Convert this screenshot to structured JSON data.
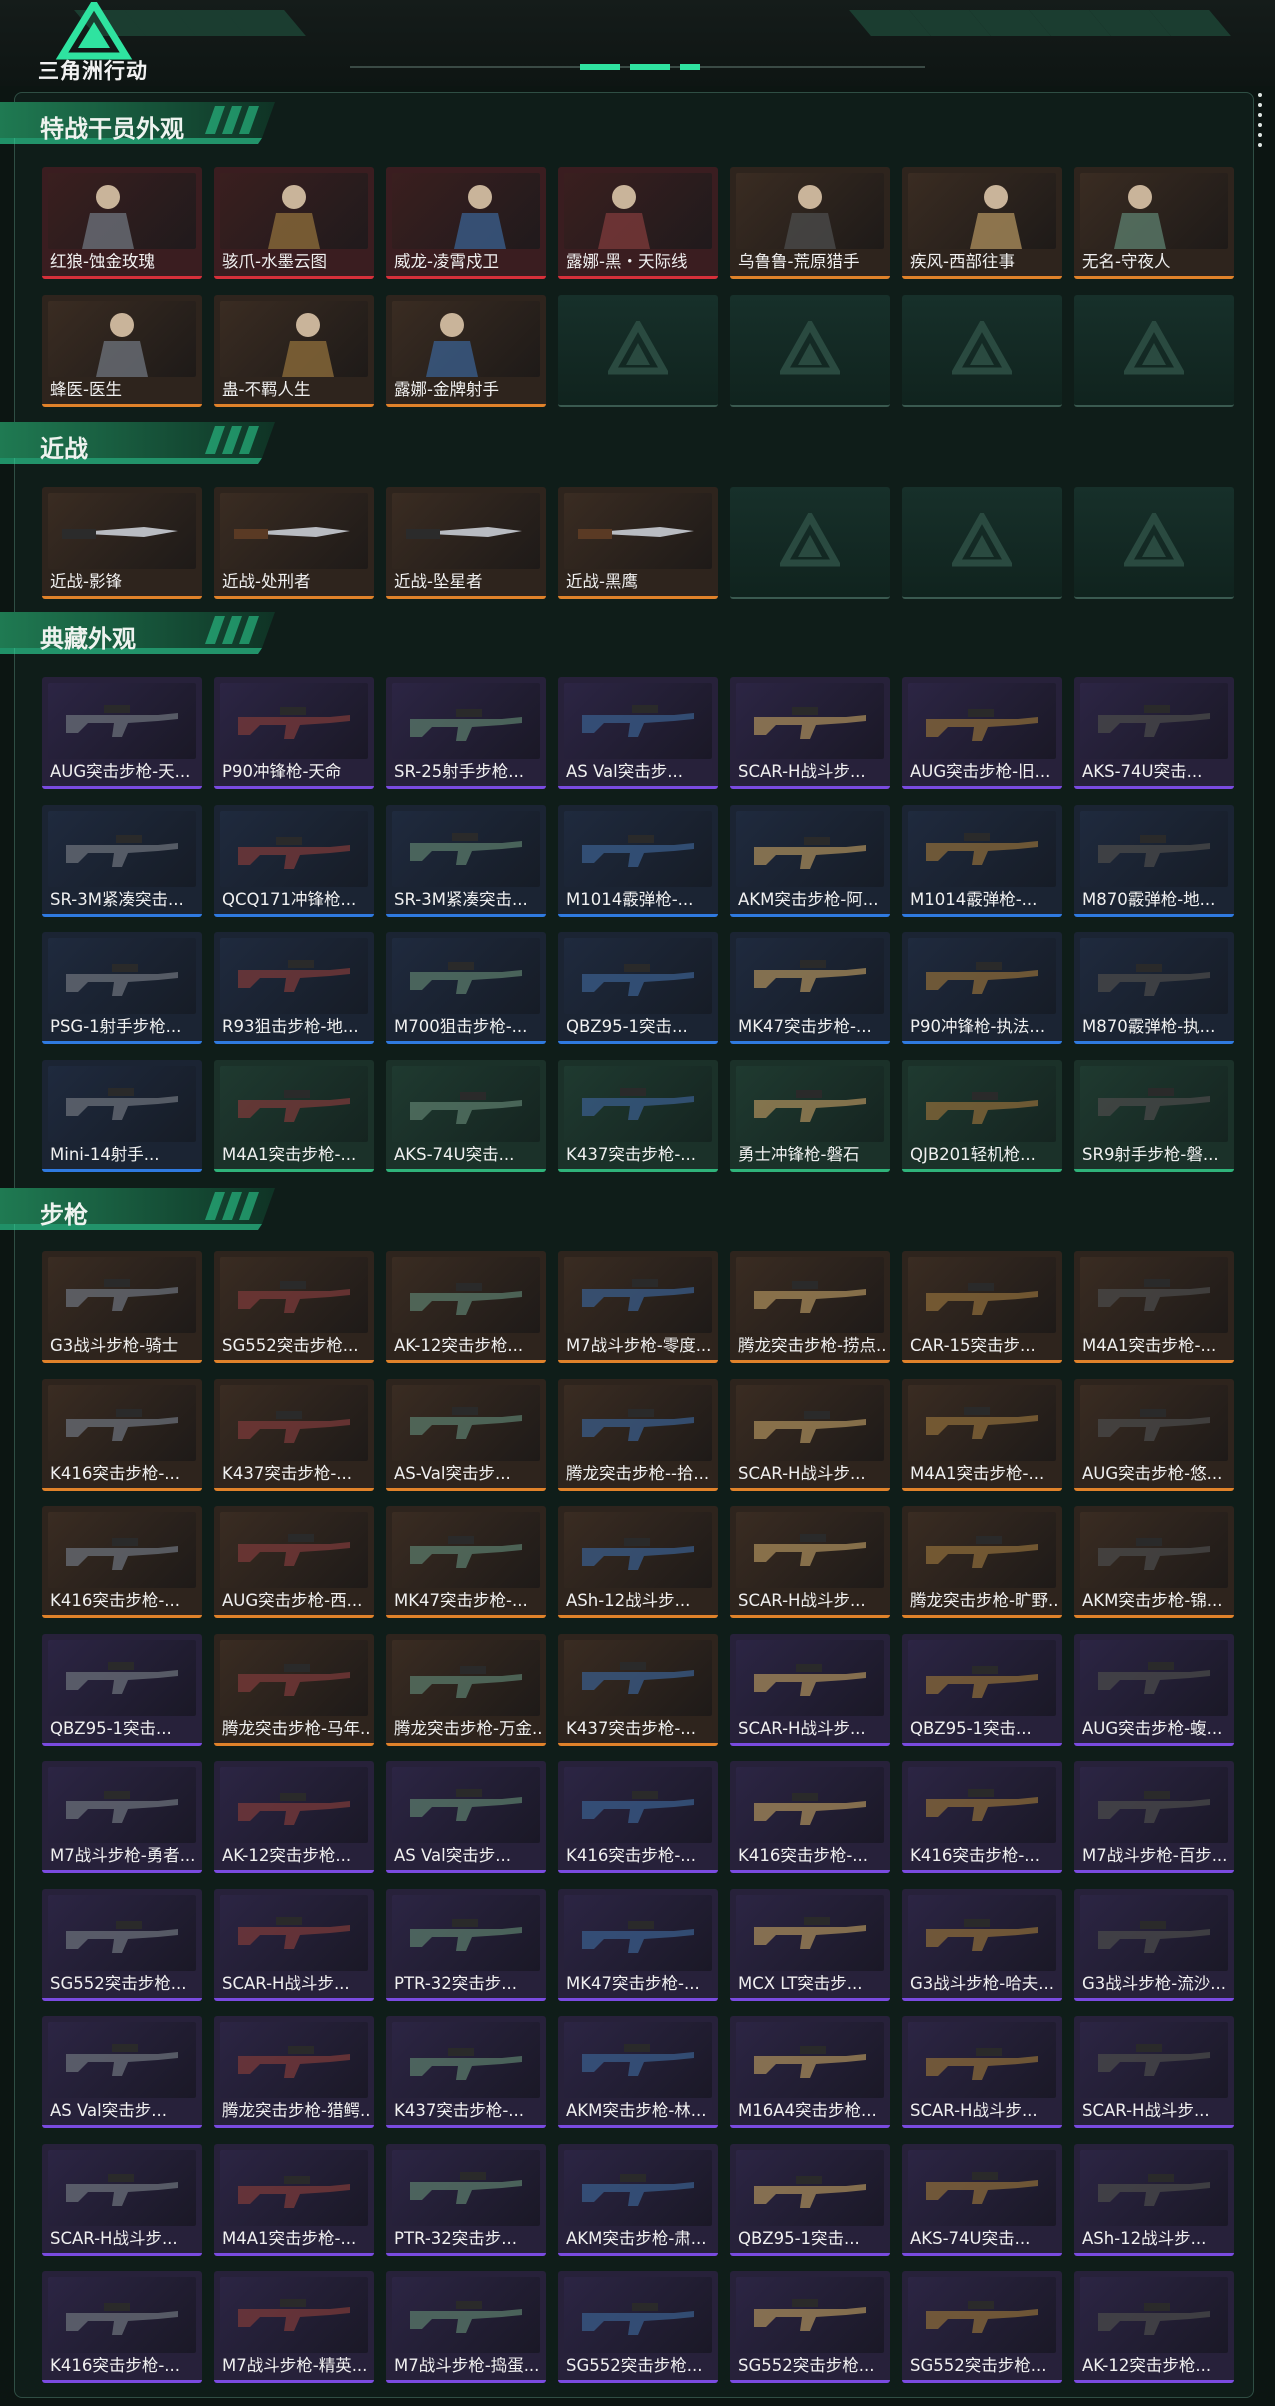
{
  "app": {
    "title": "三角洲行动"
  },
  "sections": [
    {
      "title": "特战干员外观",
      "rows": 2,
      "items": [
        {
          "label": "红狼-蚀金玫瑰",
          "rarity": "red"
        },
        {
          "label": "骇爪-水墨云图",
          "rarity": "red"
        },
        {
          "label": "威龙-凌霄戍卫",
          "rarity": "red"
        },
        {
          "label": "露娜-黑・天际线",
          "rarity": "red"
        },
        {
          "label": "乌鲁鲁-荒原猎手",
          "rarity": "orange"
        },
        {
          "label": "疾风-西部往事",
          "rarity": "orange"
        },
        {
          "label": "无名-守夜人",
          "rarity": "orange"
        },
        {
          "label": "蜂医-医生",
          "rarity": "orange"
        },
        {
          "label": "蛊-不羁人生",
          "rarity": "orange"
        },
        {
          "label": "露娜-金牌射手",
          "rarity": "orange"
        }
      ]
    },
    {
      "title": "近战",
      "rows": 1,
      "items": [
        {
          "label": "近战-影锋",
          "rarity": "orange"
        },
        {
          "label": "近战-处刑者",
          "rarity": "orange"
        },
        {
          "label": "近战-坠星者",
          "rarity": "orange"
        },
        {
          "label": "近战-黑鹰",
          "rarity": "orange"
        }
      ]
    },
    {
      "title": "典藏外观",
      "rows": 4,
      "items": [
        {
          "label": "AUG突击步枪-天...",
          "rarity": "purple"
        },
        {
          "label": "P90冲锋枪-天命",
          "rarity": "purple"
        },
        {
          "label": "SR-25射手步枪...",
          "rarity": "purple"
        },
        {
          "label": "AS Val突击步...",
          "rarity": "purple"
        },
        {
          "label": "SCAR-H战斗步...",
          "rarity": "purple"
        },
        {
          "label": "AUG突击步枪-旧...",
          "rarity": "purple"
        },
        {
          "label": "AKS-74U突击...",
          "rarity": "purple"
        },
        {
          "label": "SR-3M紧凑突击...",
          "rarity": "blue"
        },
        {
          "label": "QCQ171冲锋枪...",
          "rarity": "blue"
        },
        {
          "label": "SR-3M紧凑突击...",
          "rarity": "blue"
        },
        {
          "label": "M1014霰弹枪-...",
          "rarity": "blue"
        },
        {
          "label": "AKM突击步枪-阿...",
          "rarity": "blue"
        },
        {
          "label": "M1014霰弹枪-...",
          "rarity": "blue"
        },
        {
          "label": "M870霰弹枪-地...",
          "rarity": "blue"
        },
        {
          "label": "PSG-1射手步枪...",
          "rarity": "blue"
        },
        {
          "label": "R93狙击步枪-地...",
          "rarity": "blue"
        },
        {
          "label": "M700狙击步枪-...",
          "rarity": "blue"
        },
        {
          "label": "QBZ95-1突击...",
          "rarity": "blue"
        },
        {
          "label": "MK47突击步枪-...",
          "rarity": "blue"
        },
        {
          "label": "P90冲锋枪-执法...",
          "rarity": "blue"
        },
        {
          "label": "M870霰弹枪-执...",
          "rarity": "blue"
        },
        {
          "label": "Mini-14射手...",
          "rarity": "blue"
        },
        {
          "label": "M4A1突击步枪-...",
          "rarity": "green"
        },
        {
          "label": "AKS-74U突击...",
          "rarity": "green"
        },
        {
          "label": "K437突击步枪-...",
          "rarity": "green"
        },
        {
          "label": "勇士冲锋枪-磐石",
          "rarity": "green"
        },
        {
          "label": "QJB201轻机枪...",
          "rarity": "green"
        },
        {
          "label": "SR9射手步枪-磐...",
          "rarity": "green"
        }
      ]
    },
    {
      "title": "步枪",
      "rows": 9,
      "items": [
        {
          "label": "G3战斗步枪-骑士",
          "rarity": "orange"
        },
        {
          "label": "SG552突击步枪...",
          "rarity": "orange"
        },
        {
          "label": "AK-12突击步枪...",
          "rarity": "orange"
        },
        {
          "label": "M7战斗步枪-零度...",
          "rarity": "orange"
        },
        {
          "label": "腾龙突击步枪-捞点...",
          "rarity": "orange"
        },
        {
          "label": "CAR-15突击步...",
          "rarity": "orange"
        },
        {
          "label": "M4A1突击步枪-...",
          "rarity": "orange"
        },
        {
          "label": "K416突击步枪-...",
          "rarity": "orange"
        },
        {
          "label": "K437突击步枪-...",
          "rarity": "orange"
        },
        {
          "label": "AS-Val突击步...",
          "rarity": "orange"
        },
        {
          "label": "腾龙突击步枪--拾...",
          "rarity": "orange"
        },
        {
          "label": "SCAR-H战斗步...",
          "rarity": "orange"
        },
        {
          "label": "M4A1突击步枪-...",
          "rarity": "orange"
        },
        {
          "label": "AUG突击步枪-悠...",
          "rarity": "orange"
        },
        {
          "label": "K416突击步枪-...",
          "rarity": "orange"
        },
        {
          "label": "AUG突击步枪-西...",
          "rarity": "orange"
        },
        {
          "label": "MK47突击步枪-...",
          "rarity": "orange"
        },
        {
          "label": "ASh-12战斗步...",
          "rarity": "orange"
        },
        {
          "label": "SCAR-H战斗步...",
          "rarity": "orange"
        },
        {
          "label": "腾龙突击步枪-旷野...",
          "rarity": "orange"
        },
        {
          "label": "AKM突击步枪-锦...",
          "rarity": "orange"
        },
        {
          "label": "QBZ95-1突击...",
          "rarity": "purple"
        },
        {
          "label": "腾龙突击步枪-马年...",
          "rarity": "orange"
        },
        {
          "label": "腾龙突击步枪-万金...",
          "rarity": "orange"
        },
        {
          "label": "K437突击步枪-...",
          "rarity": "orange"
        },
        {
          "label": "SCAR-H战斗步...",
          "rarity": "purple"
        },
        {
          "label": "QBZ95-1突击...",
          "rarity": "purple"
        },
        {
          "label": "AUG突击步枪-蝮...",
          "rarity": "purple"
        },
        {
          "label": "M7战斗步枪-勇者...",
          "rarity": "purple"
        },
        {
          "label": "AK-12突击步枪...",
          "rarity": "purple"
        },
        {
          "label": "AS Val突击步...",
          "rarity": "purple"
        },
        {
          "label": "K416突击步枪-...",
          "rarity": "purple"
        },
        {
          "label": "K416突击步枪-...",
          "rarity": "purple"
        },
        {
          "label": "K416突击步枪-...",
          "rarity": "purple"
        },
        {
          "label": "M7战斗步枪-百步...",
          "rarity": "purple"
        },
        {
          "label": "SG552突击步枪...",
          "rarity": "purple"
        },
        {
          "label": "SCAR-H战斗步...",
          "rarity": "purple"
        },
        {
          "label": "PTR-32突击步...",
          "rarity": "purple"
        },
        {
          "label": "MK47突击步枪-...",
          "rarity": "purple"
        },
        {
          "label": "MCX LT突击步...",
          "rarity": "purple"
        },
        {
          "label": "G3战斗步枪-哈夫...",
          "rarity": "purple"
        },
        {
          "label": "G3战斗步枪-流沙...",
          "rarity": "purple"
        },
        {
          "label": "AS Val突击步...",
          "rarity": "purple"
        },
        {
          "label": "腾龙突击步枪-猎鳄...",
          "rarity": "purple"
        },
        {
          "label": "K437突击步枪-...",
          "rarity": "purple"
        },
        {
          "label": "AKM突击步枪-林...",
          "rarity": "purple"
        },
        {
          "label": "M16A4突击步枪...",
          "rarity": "purple"
        },
        {
          "label": "SCAR-H战斗步...",
          "rarity": "purple"
        },
        {
          "label": "SCAR-H战斗步...",
          "rarity": "purple"
        },
        {
          "label": "SCAR-H战斗步...",
          "rarity": "purple"
        },
        {
          "label": "M4A1突击步枪-...",
          "rarity": "purple"
        },
        {
          "label": "PTR-32突击步...",
          "rarity": "purple"
        },
        {
          "label": "AKM突击步枪-肃...",
          "rarity": "purple"
        },
        {
          "label": "QBZ95-1突击...",
          "rarity": "purple"
        },
        {
          "label": "AKS-74U突击...",
          "rarity": "purple"
        },
        {
          "label": "ASh-12战斗步...",
          "rarity": "purple"
        },
        {
          "label": "K416突击步枪-...",
          "rarity": "purple"
        },
        {
          "label": "M7战斗步枪-精英...",
          "rarity": "purple"
        },
        {
          "label": "M7战斗步枪-捣蛋...",
          "rarity": "purple"
        },
        {
          "label": "SG552突击步枪...",
          "rarity": "purple"
        },
        {
          "label": "SG552突击步枪...",
          "rarity": "purple"
        },
        {
          "label": "SG552突击步枪...",
          "rarity": "purple"
        },
        {
          "label": "AK-12突击步枪...",
          "rarity": "purple"
        }
      ]
    }
  ],
  "colors": {
    "red": "#d7303a",
    "orange": "#e0822a",
    "purple": "#7a4be0",
    "blue": "#2f7ae0",
    "green": "#2fb37a",
    "accent": "#2fe3a0"
  }
}
